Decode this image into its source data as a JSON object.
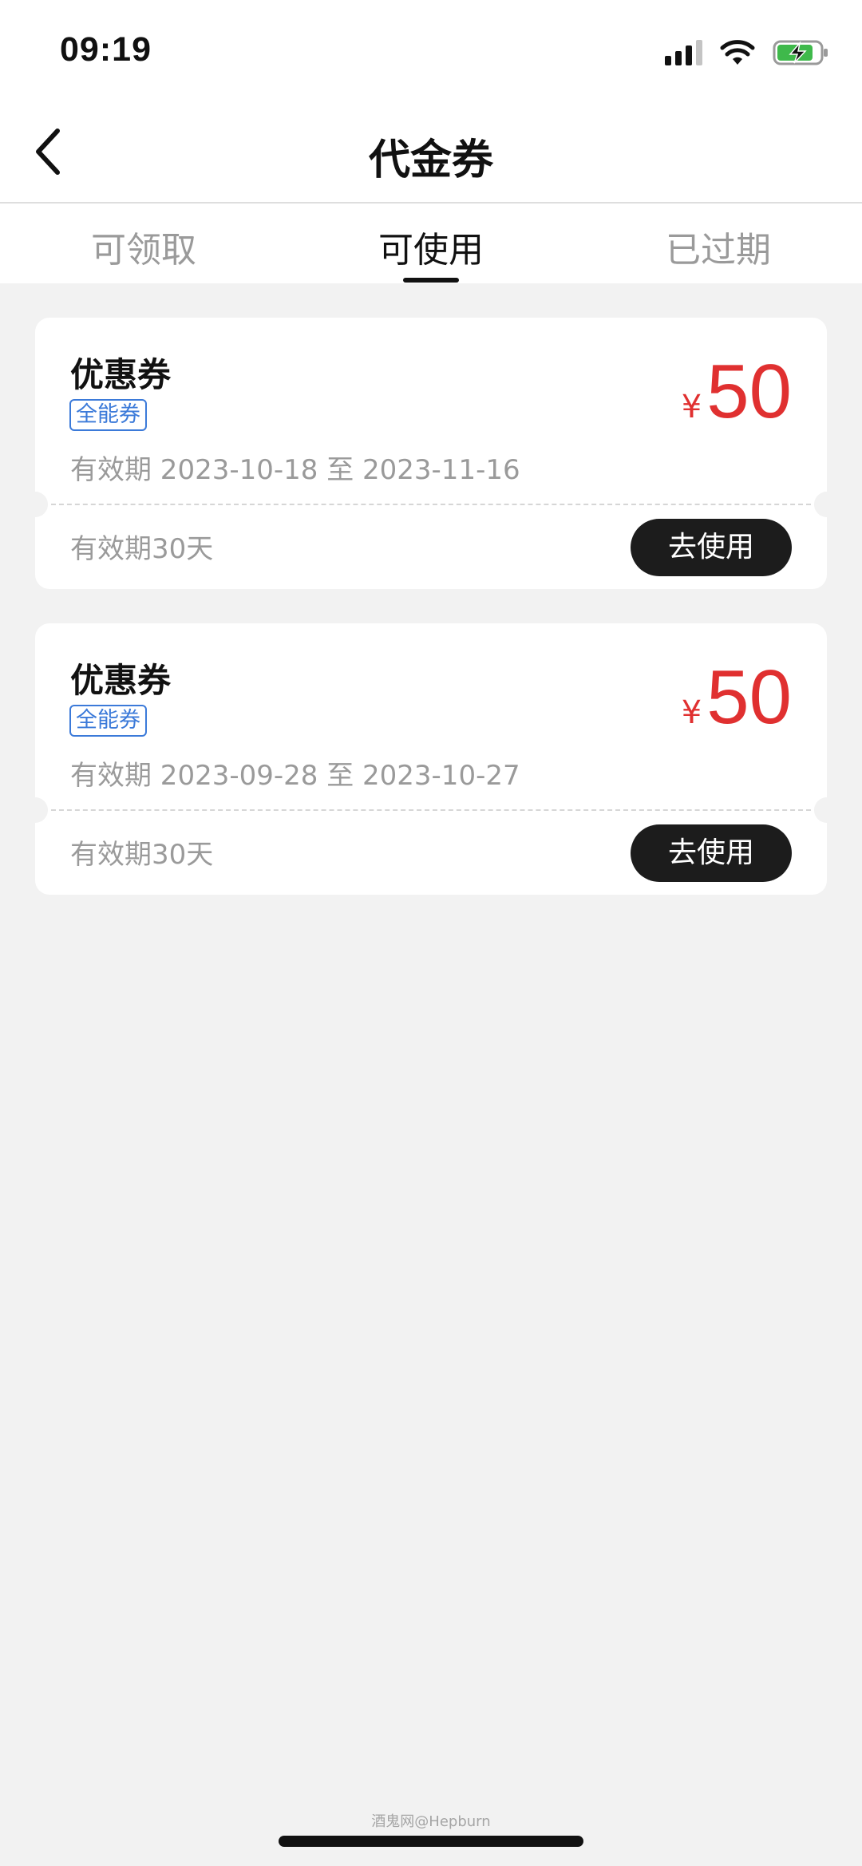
{
  "status_bar": {
    "time": "09:19"
  },
  "header": {
    "title": "代金券",
    "back_icon": "chevron-left-icon"
  },
  "tabs": [
    {
      "label": "可领取",
      "active": false
    },
    {
      "label": "可使用",
      "active": true
    },
    {
      "label": "已过期",
      "active": false
    }
  ],
  "coupons": [
    {
      "title": "优惠券",
      "tag": "全能券",
      "currency": "¥",
      "amount": "50",
      "validity": "有效期 2023-10-18 至 2023-11-16",
      "duration": "有效期30天",
      "action": "去使用"
    },
    {
      "title": "优惠券",
      "tag": "全能券",
      "currency": "¥",
      "amount": "50",
      "validity": "有效期 2023-09-28 至 2023-10-27",
      "duration": "有效期30天",
      "action": "去使用"
    }
  ],
  "watermark": "酒鬼网@Hepburn",
  "colors": {
    "price": "#e03030",
    "tag": "#3b7ad9",
    "button": "#1c1c1c",
    "background": "#f2f2f2"
  }
}
